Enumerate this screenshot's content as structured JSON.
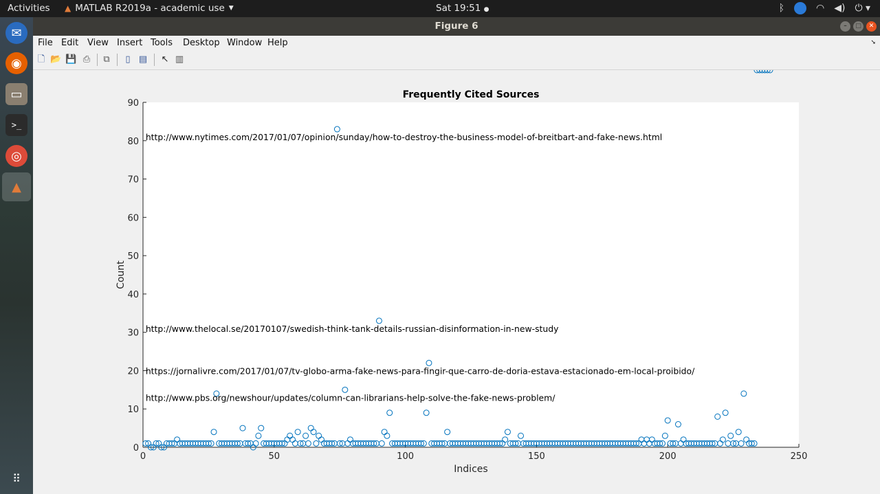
{
  "topbar": {
    "activities": "Activities",
    "app_name": "MATLAB R2019a - academic use",
    "clock": "Sat 19:51"
  },
  "icons": {
    "dock": [
      "thunderbird-icon",
      "firefox-icon",
      "files-icon",
      "terminal-icon",
      "chrome-icon",
      "matlab-icon",
      "app-grid-icon"
    ],
    "tray": [
      "bluetooth-icon",
      "update-notifier-icon",
      "wifi-icon",
      "volume-icon",
      "power-icon"
    ]
  },
  "window": {
    "title": "Figure 6"
  },
  "menu": [
    "File",
    "Edit",
    "View",
    "Insert",
    "Tools",
    "Desktop",
    "Window",
    "Help"
  ],
  "chart_data": {
    "type": "scatter",
    "title": "Frequently Cited Sources",
    "xlabel": "Indices",
    "ylabel": "Count",
    "xlim": [
      0,
      250
    ],
    "ylim": [
      0,
      90
    ],
    "xticks": [
      0,
      50,
      100,
      150,
      200,
      250
    ],
    "yticks": [
      0,
      10,
      20,
      30,
      40,
      50,
      60,
      70,
      80,
      90
    ],
    "marker_color": "#0072bd",
    "annotations": [
      {
        "text": "http://www.nytimes.com/2017/01/07/opinion/sunday/how-to-destroy-the-business-model-of-breitbart-and-fake-news.html",
        "x": 1,
        "y": 81
      },
      {
        "text": "http://www.thelocal.se/20170107/swedish-think-tank-details-russian-disinformation-in-new-study",
        "x": 1,
        "y": 31
      },
      {
        "text": "https://jornalivre.com/2017/01/07/tv-globo-arma-fake-news-para-fingir-que-carro-de-doria-estava-estacionado-em-local-proibido/",
        "x": 1,
        "y": 20
      },
      {
        "text": "http://www.pbs.org/newshour/updates/column-can-librarians-help-solve-the-fake-news-problem/",
        "x": 1,
        "y": 13
      }
    ],
    "x": [
      1,
      2,
      3,
      4,
      5,
      6,
      7,
      8,
      9,
      10,
      11,
      12,
      13,
      14,
      15,
      16,
      17,
      18,
      19,
      20,
      21,
      22,
      23,
      24,
      25,
      26,
      27,
      28,
      29,
      30,
      31,
      32,
      33,
      34,
      35,
      36,
      37,
      38,
      39,
      40,
      41,
      42,
      43,
      44,
      45,
      46,
      47,
      48,
      49,
      50,
      51,
      52,
      53,
      54,
      55,
      56,
      57,
      58,
      59,
      60,
      61,
      62,
      63,
      64,
      65,
      66,
      67,
      68,
      69,
      70,
      71,
      72,
      73,
      74,
      75,
      76,
      77,
      78,
      79,
      80,
      81,
      82,
      83,
      84,
      85,
      86,
      87,
      88,
      89,
      90,
      91,
      92,
      93,
      94,
      95,
      96,
      97,
      98,
      99,
      100,
      101,
      102,
      103,
      104,
      105,
      106,
      107,
      108,
      109,
      110,
      111,
      112,
      113,
      114,
      115,
      116,
      117,
      118,
      119,
      120,
      121,
      122,
      123,
      124,
      125,
      126,
      127,
      128,
      129,
      130,
      131,
      132,
      133,
      134,
      135,
      136,
      137,
      138,
      139,
      140,
      141,
      142,
      143,
      144,
      145,
      146,
      147,
      148,
      149,
      150,
      151,
      152,
      153,
      154,
      155,
      156,
      157,
      158,
      159,
      160,
      161,
      162,
      163,
      164,
      165,
      166,
      167,
      168,
      169,
      170,
      171,
      172,
      173,
      174,
      175,
      176,
      177,
      178,
      179,
      180,
      181,
      182,
      183,
      184,
      185,
      186,
      187,
      188,
      189,
      190,
      191,
      192,
      193,
      194,
      195,
      196,
      197,
      198,
      199,
      200,
      201,
      202,
      203,
      204,
      205,
      206,
      207,
      208,
      209,
      210,
      211,
      212,
      213,
      214,
      215,
      216,
      217,
      218,
      219,
      220,
      221,
      222,
      223,
      224,
      225,
      226,
      227,
      228,
      229,
      230,
      231,
      232,
      233,
      234,
      235,
      236,
      237,
      238,
      239
    ],
    "y": [
      1,
      1,
      0,
      0,
      1,
      1,
      0,
      0,
      1,
      1,
      1,
      1,
      2,
      1,
      1,
      1,
      1,
      1,
      1,
      1,
      1,
      1,
      1,
      1,
      1,
      1,
      4,
      14,
      1,
      1,
      1,
      1,
      1,
      1,
      1,
      1,
      1,
      5,
      1,
      1,
      1,
      0,
      1,
      3,
      5,
      1,
      1,
      1,
      1,
      1,
      1,
      1,
      1,
      1,
      2,
      3,
      2,
      1,
      4,
      1,
      1,
      3,
      1,
      5,
      4,
      1,
      3,
      2,
      1,
      1,
      1,
      1,
      1,
      83,
      1,
      1,
      15,
      1,
      2,
      1,
      1,
      1,
      1,
      1,
      1,
      1,
      1,
      1,
      1,
      33,
      1,
      4,
      3,
      9,
      1,
      1,
      1,
      1,
      1,
      1,
      1,
      1,
      1,
      1,
      1,
      1,
      1,
      9,
      22,
      1,
      1,
      1,
      1,
      1,
      1,
      4,
      1,
      1,
      1,
      1,
      1,
      1,
      1,
      1,
      1,
      1,
      1,
      1,
      1,
      1,
      1,
      1,
      1,
      1,
      1,
      1,
      1,
      2,
      4,
      1,
      1,
      1,
      1,
      3,
      1,
      1,
      1,
      1,
      1,
      1,
      1,
      1,
      1,
      1,
      1,
      1,
      1,
      1,
      1,
      1,
      1,
      1,
      1,
      1,
      1,
      1,
      1,
      1,
      1,
      1,
      1,
      1,
      1,
      1,
      1,
      1,
      1,
      1,
      1,
      1,
      1,
      1,
      1,
      1,
      1,
      1,
      1,
      1,
      1,
      2,
      1,
      2,
      1,
      2,
      1,
      1,
      1,
      1,
      3,
      7,
      1,
      1,
      1,
      6,
      1,
      2,
      1,
      1,
      1,
      1,
      1,
      1,
      1,
      1,
      1,
      1,
      1,
      1,
      8,
      1,
      2,
      9,
      1,
      3,
      1,
      1,
      4,
      1,
      14,
      2,
      1,
      1,
      1
    ]
  }
}
